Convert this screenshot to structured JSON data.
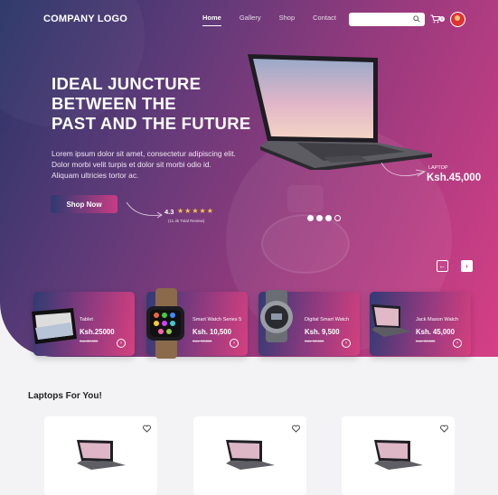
{
  "header": {
    "logo": "COMPANY LOGO",
    "nav": [
      {
        "label": "Home",
        "active": true
      },
      {
        "label": "Gallery",
        "active": false
      },
      {
        "label": "Shop",
        "active": false
      },
      {
        "label": "Contact",
        "active": false
      }
    ],
    "search_placeholder": "",
    "cart_count": "0"
  },
  "hero": {
    "headline_lines": [
      "IDEAL JUNCTURE",
      "BETWEEN THE",
      "PAST AND THE FUTURE"
    ],
    "blurb_lines": [
      "Lorem ipsum dolor sit amet, consectetur adipiscing elit.",
      "Dolor morbi velit turpis et dolor sit morbi odio id.",
      "Aliquam ultricies tortor ac."
    ],
    "cta": "Shop Now",
    "rating": "4.3",
    "stars": "★★★★★",
    "reviews": "(11.4k Total Review)",
    "product_label": "LAPTOP",
    "product_price": "Ksh.45,000",
    "carousel_count": 4,
    "carousel_active": 0
  },
  "cards": [
    {
      "name": "Tablet",
      "price": "Ksh.25000",
      "old": "Ksh.30,000",
      "icon": "tablet"
    },
    {
      "name": "Smart Watch Series 5",
      "price": "Ksh. 10,500",
      "old": "Ksh. 13,500",
      "icon": "smartwatch"
    },
    {
      "name": "Digital Smart Watch",
      "price": "Ksh. 9,500",
      "old": "Ksh. 12,000",
      "icon": "digital-watch"
    },
    {
      "name": "Jack Mason Watch",
      "price": "Ksh. 45,000",
      "old": "Ksh. 50,000",
      "icon": "laptop"
    }
  ],
  "section": {
    "title": "Laptops For You!"
  },
  "colors": {
    "hero_start": "#2a3568",
    "hero_end": "#d63f86",
    "star": "#f7c548"
  }
}
